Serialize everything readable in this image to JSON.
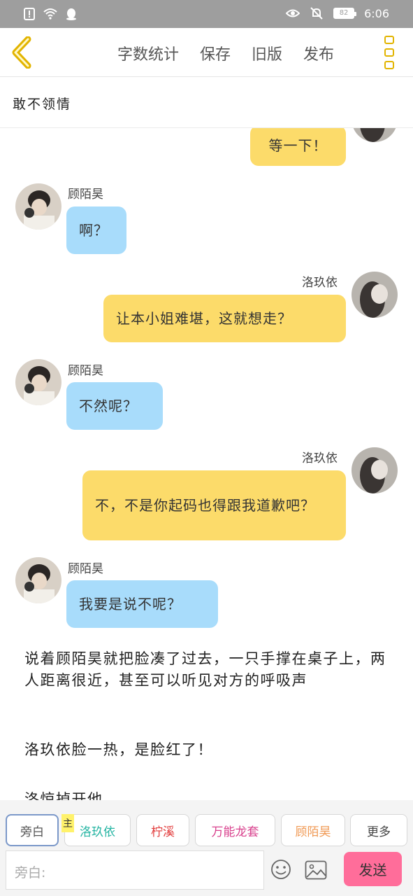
{
  "status_bar": {
    "time": "6:06",
    "battery": "82"
  },
  "nav": {
    "word_count": "字数统计",
    "save": "保存",
    "old_version": "旧版",
    "publish": "发布"
  },
  "title": "敢不领情",
  "messages": [
    {
      "sender": "洛玖依",
      "side": "right",
      "text": "等一下！"
    },
    {
      "sender": "顾陌昊",
      "side": "left",
      "text": "啊？"
    },
    {
      "sender": "洛玖依",
      "side": "right",
      "text": "让本小姐难堪，这就想走？"
    },
    {
      "sender": "顾陌昊",
      "side": "left",
      "text": "不然呢？"
    },
    {
      "sender": "洛玖依",
      "side": "right",
      "text": "不，不是你起码也得跟我道歉吧？"
    },
    {
      "sender": "顾陌昊",
      "side": "left",
      "text": "我要是说不呢？"
    }
  ],
  "narrations": [
    "说着顾陌昊就把脸凑了过去，一只手撑在桌子上，两人距离很近，甚至可以听见对方的呼吸声",
    "洛玖依脸一热，是脸红了！",
    "洛惊掉开他"
  ],
  "roles": {
    "aside": "旁白",
    "main_tag": "主",
    "items": [
      {
        "label": "洛玖依",
        "color": "#26b5a3"
      },
      {
        "label": "柠溪",
        "color": "#e23b3b"
      },
      {
        "label": "万能龙套",
        "color": "#d83f8c"
      },
      {
        "label": "顾陌昊",
        "color": "#f09a55"
      },
      {
        "label": "更多",
        "color": "#444444"
      }
    ]
  },
  "input": {
    "placeholder": "旁白:"
  },
  "send": "发送",
  "colors": {
    "accent_yellow": "#e2b400",
    "bubble_yellow": "#fcdb6a",
    "bubble_blue": "#a8dcfb",
    "send_pink": "#ff6d9a"
  }
}
